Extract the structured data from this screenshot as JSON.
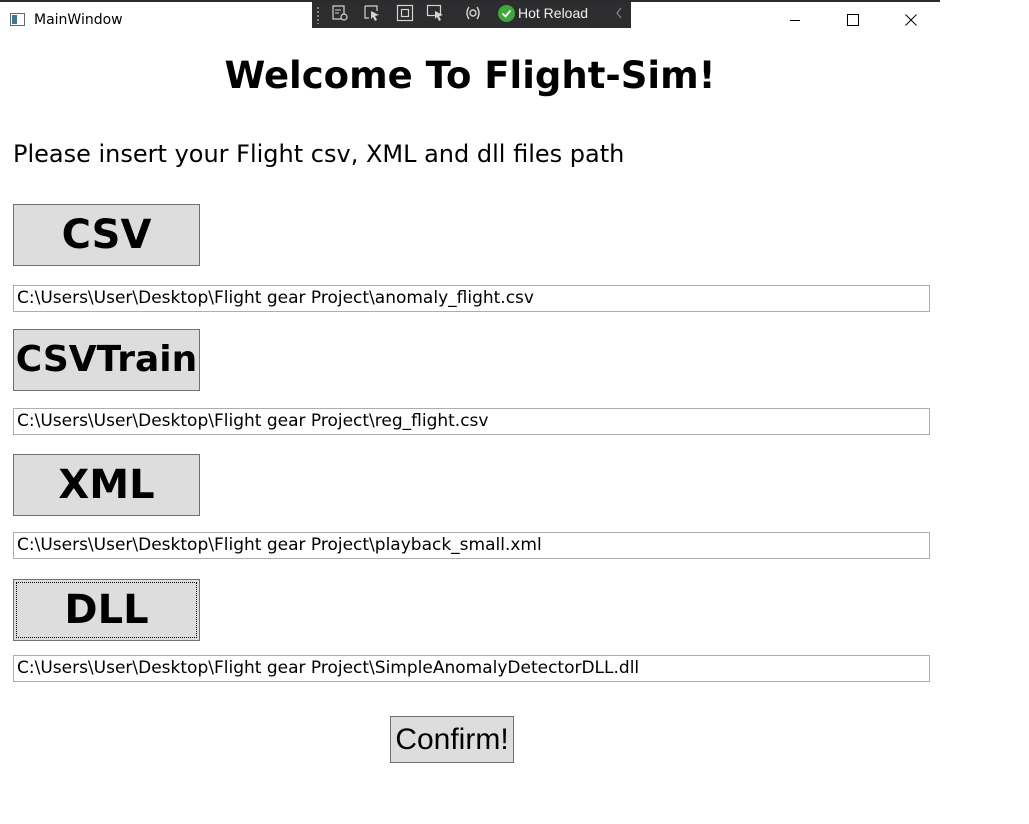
{
  "window": {
    "title": "MainWindow",
    "controls": [
      "minimize-icon",
      "maximize-icon",
      "close-icon"
    ]
  },
  "dev_toolbar": {
    "icons": [
      "select-element-icon",
      "inspect-pointer-icon",
      "layout-adorner-icon",
      "track-focus-icon",
      "binding-failures-icon"
    ],
    "hot_reload_label": "Hot Reload",
    "hot_reload_status_color": "#3ea83e"
  },
  "main": {
    "heading": "Welcome To Flight-Sim!",
    "instructions": "Please insert your Flight csv, XML and dll files path",
    "files": [
      {
        "button_label": "CSV",
        "path": "C:\\Users\\User\\Desktop\\Flight gear Project\\anomaly_flight.csv"
      },
      {
        "button_label": "CSVTrain",
        "path": "C:\\Users\\User\\Desktop\\Flight gear Project\\reg_flight.csv"
      },
      {
        "button_label": "XML",
        "path": "C:\\Users\\User\\Desktop\\Flight gear Project\\playback_small.xml"
      },
      {
        "button_label": "DLL",
        "path": "C:\\Users\\User\\Desktop\\Flight gear Project\\SimpleAnomalyDetectorDLL.dll"
      }
    ],
    "confirm_label": "Confirm!"
  },
  "colors": {
    "button_bg": "#dddddd",
    "button_border": "#707070",
    "field_border": "#abadb3",
    "dev_toolbar_bg": "#2d2d30"
  }
}
